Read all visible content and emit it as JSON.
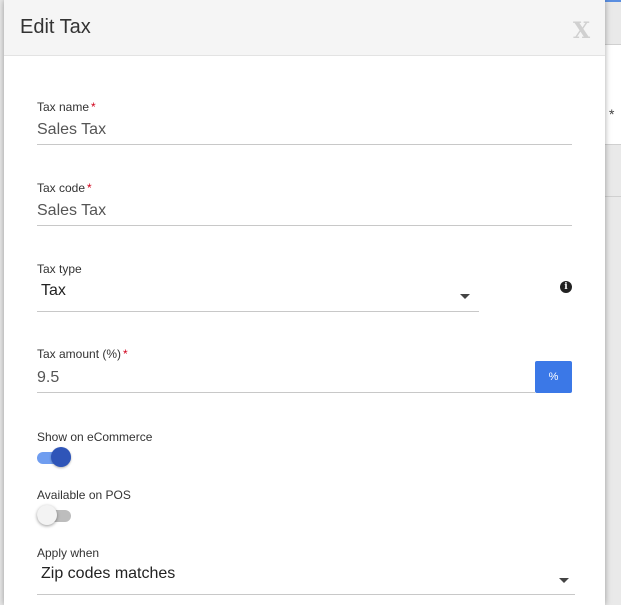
{
  "dialog": {
    "title": "Edit Tax",
    "close_label": "X"
  },
  "background": {
    "star": "*"
  },
  "fields": {
    "tax_name": {
      "label": "Tax name",
      "required": "*",
      "value": "Sales Tax"
    },
    "tax_code": {
      "label": "Tax code",
      "required": "*",
      "value": "Sales Tax"
    },
    "tax_type": {
      "label": "Tax type",
      "selected": "Tax",
      "info_icon": "info-icon"
    },
    "tax_amount": {
      "label": "Tax amount (%)",
      "required": "*",
      "value": "9.5",
      "unit_button": "%"
    },
    "show_on_ecommerce": {
      "label": "Show on eCommerce",
      "checked": true
    },
    "available_on_pos": {
      "label": "Available on POS",
      "checked": false
    },
    "apply_when": {
      "label": "Apply when",
      "selected": "Zip codes matches"
    }
  },
  "colors": {
    "accent": "#3b78e7",
    "toggle_on_knob": "#2f55b8",
    "toggle_on_track": "#6f9df0",
    "required": "#d0021b"
  }
}
